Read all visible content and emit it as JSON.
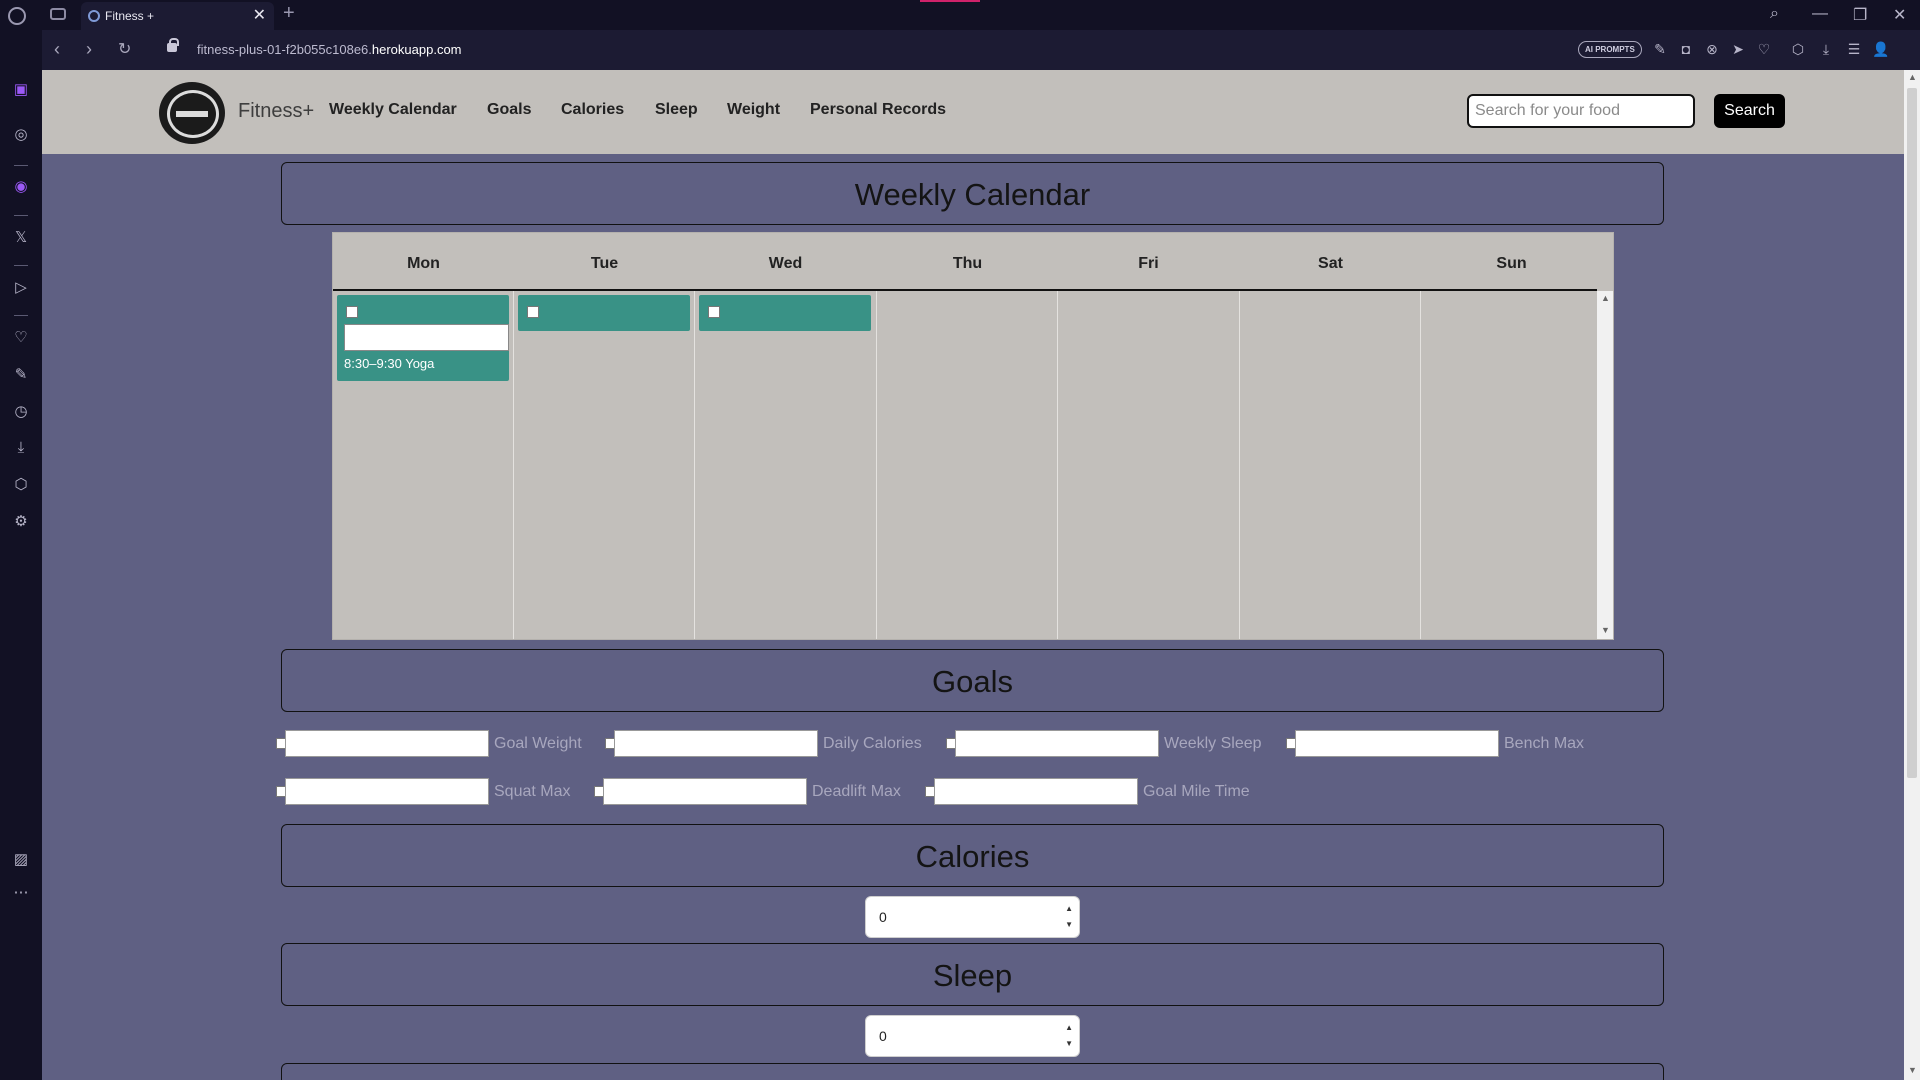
{
  "browser": {
    "tab_title": "Fitness +",
    "new_tab": "+",
    "url_prefix": "fitness-plus-01-f2b055c108e6.",
    "url_domain": "herokuapp.com",
    "ai_badge": "AI PROMPTS"
  },
  "navbar": {
    "brand": "Fitness+",
    "links": [
      "Weekly Calendar",
      "Goals",
      "Calories",
      "Sleep",
      "Weight",
      "Personal Records"
    ],
    "search_placeholder": "Search for your food",
    "search_button": "Search"
  },
  "calendar": {
    "title": "Weekly Calendar",
    "days": [
      "Mon",
      "Tue",
      "Wed",
      "Thu",
      "Fri",
      "Sat",
      "Sun"
    ],
    "events": [
      {
        "day": "Mon",
        "label": "8:30–9:30 Yoga",
        "editing": true
      },
      {
        "day": "Tue",
        "label": "",
        "editing": false
      },
      {
        "day": "Wed",
        "label": "",
        "editing": false
      }
    ]
  },
  "goals": {
    "title": "Goals",
    "items": [
      "Goal Weight",
      "Daily Calories",
      "Weekly Sleep",
      "Bench Max",
      "Squat Max",
      "Deadlift Max",
      "Goal Mile Time"
    ]
  },
  "calories": {
    "title": "Calories",
    "value": "0"
  },
  "sleep": {
    "title": "Sleep",
    "value": "0"
  },
  "colors": {
    "page_bg": "#5f6083",
    "navbar_bg": "#c2bfbb",
    "event_bg": "#399286",
    "chrome_bg": "#121124"
  }
}
